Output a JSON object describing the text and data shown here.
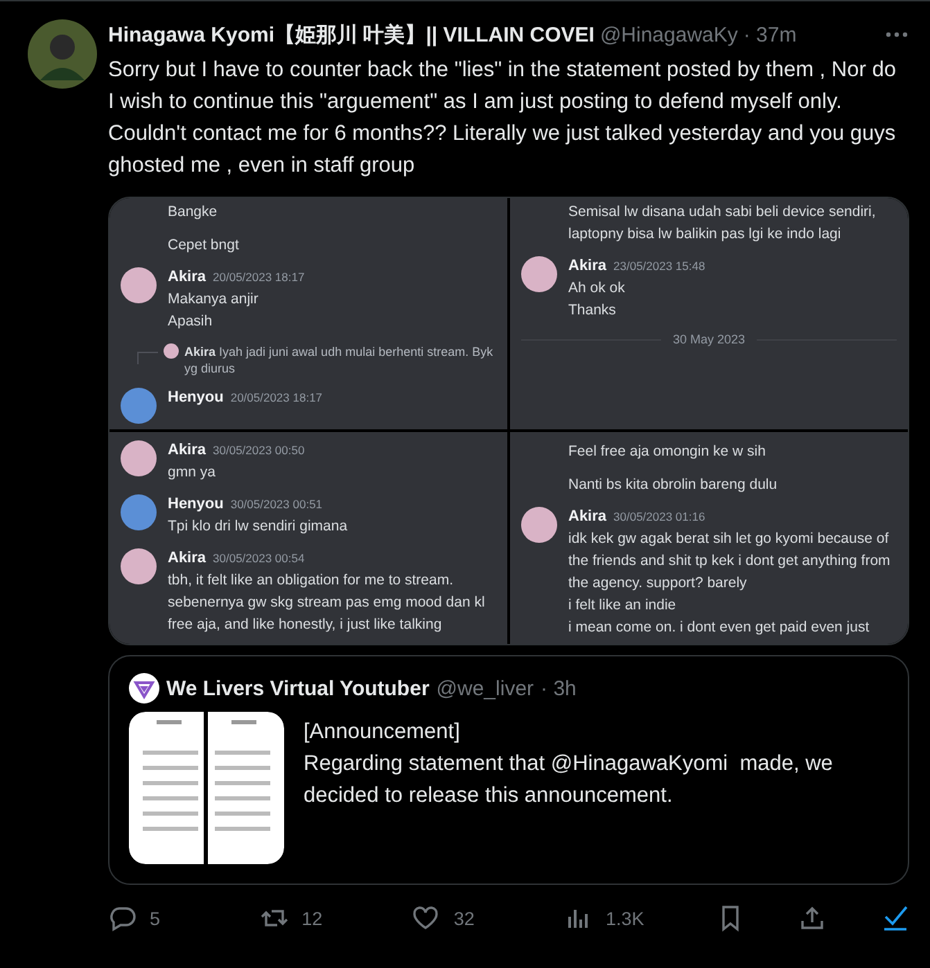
{
  "tweet": {
    "author": {
      "name": "Hinagawa Kyomi【姫那川 叶美】|| VILLAIN COVEI",
      "handle": "@HinagawaKy",
      "time": "· 37m"
    },
    "text": "Sorry but I have to counter back the \"lies\" in the statement posted by them , Nor do I wish to continue this \"arguement\" as I am just posting to defend myself only. Couldn't contact me for 6 months?? Literally we just talked yesterday and you guys ghosted me , even in staff group",
    "media": [
      {
        "items": [
          {
            "kind": "line",
            "text": "Bangke"
          },
          {
            "kind": "line",
            "text": "Cepet bngt"
          },
          {
            "kind": "message",
            "author": "Akira",
            "time": "20/05/2023 18:17",
            "color": "#d9b3c6",
            "lines": [
              "Makanya anjir",
              "Apasih"
            ]
          },
          {
            "kind": "reply",
            "author": "Akira",
            "color": "#d9b3c6",
            "text": "Iyah jadi juni awal udh mulai berhenti stream. Byk yg diurus"
          },
          {
            "kind": "message",
            "author": "Henyou",
            "time": "20/05/2023 18:17",
            "color": "#5b8fd6"
          }
        ]
      },
      {
        "items": [
          {
            "kind": "line",
            "text": "Semisal lw disana udah sabi beli device sendiri, laptopny bisa lw balikin pas lgi ke indo lagi"
          },
          {
            "kind": "message",
            "author": "Akira",
            "time": "23/05/2023 15:48",
            "color": "#d9b3c6",
            "lines": [
              "Ah ok ok",
              "Thanks"
            ]
          },
          {
            "kind": "divider",
            "text": "30 May 2023"
          }
        ]
      },
      {
        "items": [
          {
            "kind": "message",
            "author": "Akira",
            "time": "30/05/2023 00:50",
            "color": "#d9b3c6",
            "lines": [
              "gmn ya"
            ]
          },
          {
            "kind": "message",
            "author": "Henyou",
            "time": "30/05/2023 00:51",
            "color": "#5b8fd6",
            "lines": [
              "Tpi klo dri lw sendiri gimana"
            ]
          },
          {
            "kind": "message",
            "author": "Akira",
            "time": "30/05/2023 00:54",
            "color": "#d9b3c6",
            "lines": [
              "tbh, it felt like an obligation for me to stream. sebenernya gw skg stream pas emg mood dan kl free aja, and like honestly, i just like talking"
            ]
          }
        ]
      },
      {
        "items": [
          {
            "kind": "line",
            "text": "Feel free aja omongin ke w sih"
          },
          {
            "kind": "line",
            "text": "Nanti bs kita obrolin bareng dulu"
          },
          {
            "kind": "message",
            "author": "Akira",
            "time": "30/05/2023 01:16",
            "color": "#d9b3c6",
            "lines": [
              "idk kek gw agak berat sih let go kyomi because of the friends and shit tp kek i dont get anything from the agency. support? barely",
              "i felt like an indie",
              "i mean come on. i dont even get paid even just"
            ]
          }
        ]
      }
    ],
    "quote": {
      "name": "We Livers Virtual Youtuber",
      "handle": "@we_liver",
      "time": "· 3h",
      "text": "[Announcement]\nRegarding statement that @HinagawaKyomi  made, we decided to release this announcement."
    },
    "actions": [
      {
        "kind": "reply",
        "count": "5"
      },
      {
        "kind": "retweet",
        "count": "12"
      },
      {
        "kind": "like",
        "count": "32"
      },
      {
        "kind": "views",
        "count": "1.3K"
      },
      {
        "kind": "bookmark"
      },
      {
        "kind": "share"
      },
      {
        "kind": "check"
      }
    ]
  }
}
